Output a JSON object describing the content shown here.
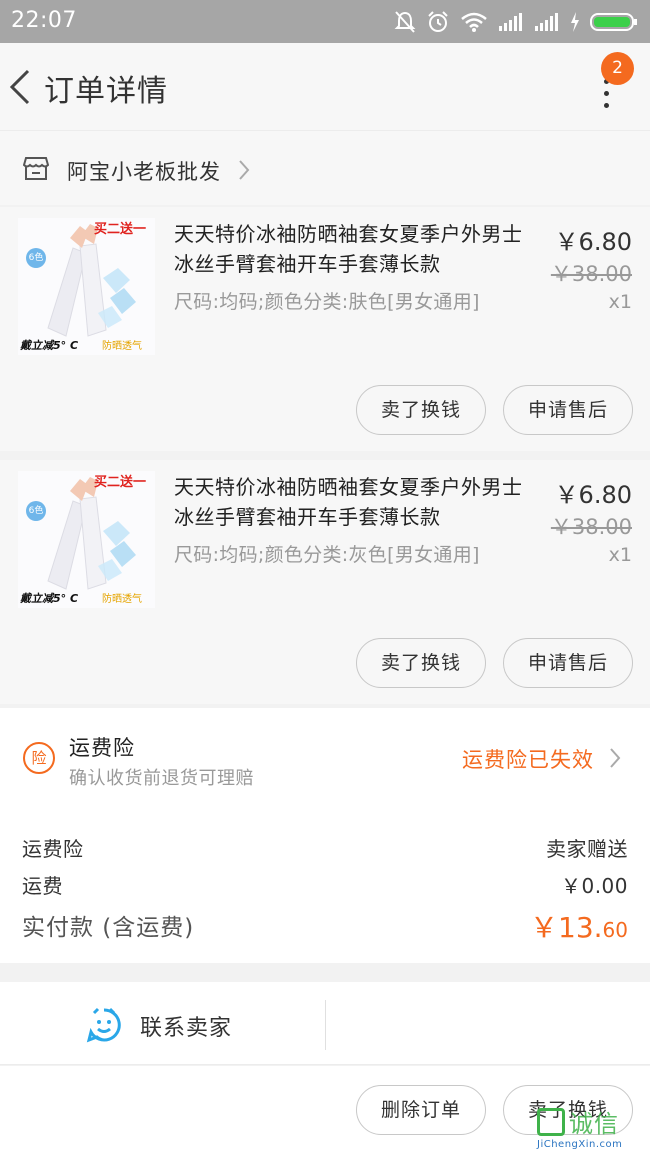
{
  "status_bar": {
    "time": "22:07"
  },
  "header": {
    "title": "订单详情",
    "badge_count": "2"
  },
  "shop": {
    "name": "阿宝小老板批发"
  },
  "items": [
    {
      "title": "天天特价冰袖防晒袖套女夏季户外男士冰丝手臂套袖开车手套薄长款",
      "sku": "尺码:均码;颜色分类:肤色[男女通用]",
      "price": "￥6.80",
      "original_price": "￥38.00",
      "quantity": "x1",
      "image": {
        "promo": "买二送一",
        "tag_left": "戴立减5° C",
        "tag_right": "防晒透气",
        "badge": "6色"
      },
      "actions": [
        "卖了换钱",
        "申请售后"
      ]
    },
    {
      "title": "天天特价冰袖防晒袖套女夏季户外男士冰丝手臂套袖开车手套薄长款",
      "sku": "尺码:均码;颜色分类:灰色[男女通用]",
      "price": "￥6.80",
      "original_price": "￥38.00",
      "quantity": "x1",
      "image": {
        "promo": "买二送一",
        "tag_left": "戴立减5° C",
        "tag_right": "防晒透气",
        "badge": "6色"
      },
      "actions": [
        "卖了换钱",
        "申请售后"
      ]
    }
  ],
  "insurance": {
    "icon_text": "险",
    "title": "运费险",
    "subtitle": "确认收货前退货可理赔",
    "status": "运费险已失效"
  },
  "summary": {
    "rows": [
      {
        "label": "运费险",
        "value": "卖家赠送"
      },
      {
        "label": "运费",
        "value": "￥0.00"
      }
    ],
    "paid_label": "实付款 (含运费)",
    "paid_main": "￥13.",
    "paid_cents": "60"
  },
  "contact": {
    "label": "联系卖家"
  },
  "bottom_actions": [
    "删除订单",
    "卖了换钱"
  ],
  "watermark": {
    "text": "诚信",
    "sub": "JiChengXin.com"
  },
  "colors": {
    "accent": "#f46a1f",
    "status_bar": "#a6a6a6",
    "background": "#f7f7f7"
  }
}
